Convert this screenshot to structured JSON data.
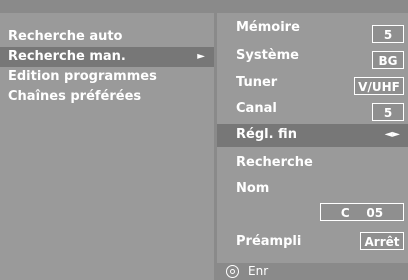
{
  "menu": {
    "items": [
      {
        "label": "Recherche auto"
      },
      {
        "label": "Recherche man.",
        "arrow": "►"
      },
      {
        "label": "Edition programmes"
      },
      {
        "label": "Chaînes préférées"
      }
    ]
  },
  "settings": {
    "memoire": {
      "label": "Mémoire",
      "value": "5"
    },
    "systeme": {
      "label": "Système",
      "value": "BG"
    },
    "tuner": {
      "label": "Tuner",
      "value": "V/UHF"
    },
    "canal": {
      "label": "Canal",
      "value": "5"
    },
    "regl_fin": {
      "label": "Régl. fin",
      "arrows": "◄►"
    },
    "recherche": {
      "label": "Recherche"
    },
    "nom": {
      "label": "Nom",
      "value": "C    05"
    },
    "preampli": {
      "label": "Préampli",
      "value": "Arrêt"
    }
  },
  "footer": {
    "icon": "ok-button-icon",
    "label": "Enr"
  }
}
